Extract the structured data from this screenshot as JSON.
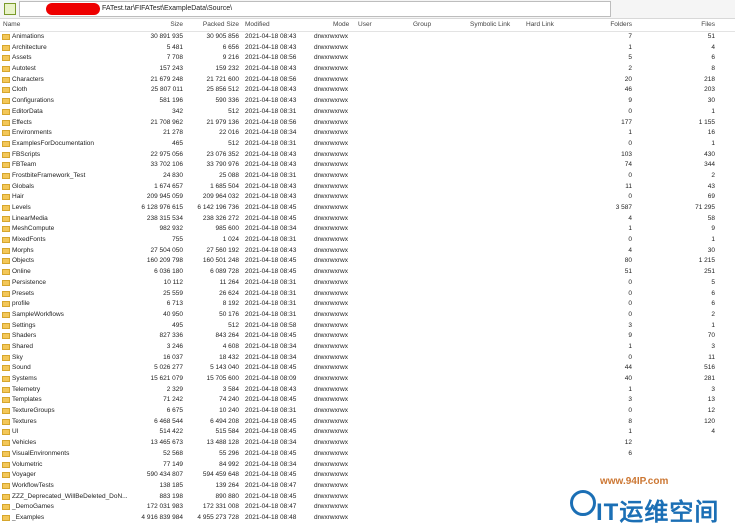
{
  "address_bar": {
    "path": "FATest.tar\\FIFATest\\ExampleData\\Source\\"
  },
  "columns": {
    "name": "Name",
    "size": "Size",
    "packed": "Packed Size",
    "modified": "Modified",
    "mode": "Mode",
    "user": "User",
    "group": "Group",
    "symlink": "Symbolic Link",
    "hardlink": "Hard Link",
    "folders": "Folders",
    "files": "Files"
  },
  "rows": [
    {
      "name": "Animations",
      "size": "30 891 935",
      "packed": "30 905 856",
      "modified": "2021-04-18 08:43",
      "mode": "drwxrwxrwx",
      "folders": "7",
      "files": "51"
    },
    {
      "name": "Architecture",
      "size": "5 481",
      "packed": "6 656",
      "modified": "2021-04-18 08:43",
      "mode": "drwxrwxrwx",
      "folders": "1",
      "files": "4"
    },
    {
      "name": "Assets",
      "size": "7 708",
      "packed": "9 216",
      "modified": "2021-04-18 08:56",
      "mode": "drwxrwxrwx",
      "folders": "5",
      "files": "6"
    },
    {
      "name": "Autotest",
      "size": "157 243",
      "packed": "159 232",
      "modified": "2021-04-18 08:43",
      "mode": "drwxrwxrwx",
      "folders": "2",
      "files": "8"
    },
    {
      "name": "Characters",
      "size": "21 679 248",
      "packed": "21 721 600",
      "modified": "2021-04-18 08:56",
      "mode": "drwxrwxrwx",
      "folders": "20",
      "files": "218"
    },
    {
      "name": "Cloth",
      "size": "25 807 011",
      "packed": "25 856 512",
      "modified": "2021-04-18 08:43",
      "mode": "drwxrwxrwx",
      "folders": "46",
      "files": "203"
    },
    {
      "name": "Configurations",
      "size": "581 196",
      "packed": "590 336",
      "modified": "2021-04-18 08:43",
      "mode": "drwxrwxrwx",
      "folders": "9",
      "files": "30"
    },
    {
      "name": "EditorData",
      "size": "342",
      "packed": "512",
      "modified": "2021-04-18 08:31",
      "mode": "drwxrwxrwx",
      "folders": "0",
      "files": "1"
    },
    {
      "name": "Effects",
      "size": "21 708 962",
      "packed": "21 979 136",
      "modified": "2021-04-18 08:56",
      "mode": "drwxrwxrwx",
      "folders": "177",
      "files": "1 155"
    },
    {
      "name": "Environments",
      "size": "21 278",
      "packed": "22 016",
      "modified": "2021-04-18 08:34",
      "mode": "drwxrwxrwx",
      "folders": "1",
      "files": "16"
    },
    {
      "name": "ExamplesForDocumentation",
      "size": "465",
      "packed": "512",
      "modified": "2021-04-18 08:31",
      "mode": "drwxrwxrwx",
      "folders": "0",
      "files": "1"
    },
    {
      "name": "FBScripts",
      "size": "22 975 056",
      "packed": "23 076 352",
      "modified": "2021-04-18 08:43",
      "mode": "drwxrwxrwx",
      "folders": "103",
      "files": "430"
    },
    {
      "name": "FBTeam",
      "size": "33 702 106",
      "packed": "33 790 976",
      "modified": "2021-04-18 08:43",
      "mode": "drwxrwxrwx",
      "folders": "74",
      "files": "344"
    },
    {
      "name": "FrostbiteFramework_Test",
      "size": "24 830",
      "packed": "25 088",
      "modified": "2021-04-18 08:31",
      "mode": "drwxrwxrwx",
      "folders": "0",
      "files": "2"
    },
    {
      "name": "Globals",
      "size": "1 674 657",
      "packed": "1 685 504",
      "modified": "2021-04-18 08:43",
      "mode": "drwxrwxrwx",
      "folders": "11",
      "files": "43"
    },
    {
      "name": "Hair",
      "size": "209 945 059",
      "packed": "209 964 032",
      "modified": "2021-04-18 08:43",
      "mode": "drwxrwxrwx",
      "folders": "0",
      "files": "69"
    },
    {
      "name": "Levels",
      "size": "6 128 976 615",
      "packed": "6 142 196 736",
      "modified": "2021-04-18 08:45",
      "mode": "drwxrwxrwx",
      "folders": "3 587",
      "files": "71 295"
    },
    {
      "name": "LinearMedia",
      "size": "238 315 534",
      "packed": "238 326 272",
      "modified": "2021-04-18 08:45",
      "mode": "drwxrwxrwx",
      "folders": "4",
      "files": "58"
    },
    {
      "name": "MeshCompute",
      "size": "982 932",
      "packed": "985 600",
      "modified": "2021-04-18 08:34",
      "mode": "drwxrwxrwx",
      "folders": "1",
      "files": "9"
    },
    {
      "name": "MixedFonts",
      "size": "755",
      "packed": "1 024",
      "modified": "2021-04-18 08:31",
      "mode": "drwxrwxrwx",
      "folders": "0",
      "files": "1"
    },
    {
      "name": "Morphs",
      "size": "27 504 050",
      "packed": "27 560 192",
      "modified": "2021-04-18 08:43",
      "mode": "drwxrwxrwx",
      "folders": "4",
      "files": "30"
    },
    {
      "name": "Objects",
      "size": "160 209 798",
      "packed": "160 501 248",
      "modified": "2021-04-18 08:45",
      "mode": "drwxrwxrwx",
      "folders": "80",
      "files": "1 215"
    },
    {
      "name": "Online",
      "size": "6 036 180",
      "packed": "6 089 728",
      "modified": "2021-04-18 08:45",
      "mode": "drwxrwxrwx",
      "folders": "51",
      "files": "251"
    },
    {
      "name": "Persistence",
      "size": "10 112",
      "packed": "11 264",
      "modified": "2021-04-18 08:31",
      "mode": "drwxrwxrwx",
      "folders": "0",
      "files": "5"
    },
    {
      "name": "Presets",
      "size": "25 559",
      "packed": "26 624",
      "modified": "2021-04-18 08:31",
      "mode": "drwxrwxrwx",
      "folders": "0",
      "files": "6"
    },
    {
      "name": "profile",
      "size": "6 713",
      "packed": "8 192",
      "modified": "2021-04-18 08:31",
      "mode": "drwxrwxrwx",
      "folders": "0",
      "files": "6"
    },
    {
      "name": "SampleWorkflows",
      "size": "40 950",
      "packed": "50 176",
      "modified": "2021-04-18 08:31",
      "mode": "drwxrwxrwx",
      "folders": "0",
      "files": "2"
    },
    {
      "name": "Settings",
      "size": "495",
      "packed": "512",
      "modified": "2021-04-18 08:58",
      "mode": "drwxrwxrwx",
      "folders": "3",
      "files": "1"
    },
    {
      "name": "Shaders",
      "size": "827 336",
      "packed": "843 264",
      "modified": "2021-04-18 08:45",
      "mode": "drwxrwxrwx",
      "folders": "9",
      "files": "70"
    },
    {
      "name": "Shared",
      "size": "3 246",
      "packed": "4 608",
      "modified": "2021-04-18 08:34",
      "mode": "drwxrwxrwx",
      "folders": "1",
      "files": "3"
    },
    {
      "name": "Sky",
      "size": "16 037",
      "packed": "18 432",
      "modified": "2021-04-18 08:34",
      "mode": "drwxrwxrwx",
      "folders": "0",
      "files": "11"
    },
    {
      "name": "Sound",
      "size": "5 026 277",
      "packed": "5 143 040",
      "modified": "2021-04-18 08:45",
      "mode": "drwxrwxrwx",
      "folders": "44",
      "files": "516"
    },
    {
      "name": "Systems",
      "size": "15 621 079",
      "packed": "15 705 600",
      "modified": "2021-04-18 08:09",
      "mode": "drwxrwxrwx",
      "folders": "40",
      "files": "281"
    },
    {
      "name": "Telemetry",
      "size": "2 329",
      "packed": "3 584",
      "modified": "2021-04-18 08:43",
      "mode": "drwxrwxrwx",
      "folders": "1",
      "files": "3"
    },
    {
      "name": "Templates",
      "size": "71 242",
      "packed": "74 240",
      "modified": "2021-04-18 08:45",
      "mode": "drwxrwxrwx",
      "folders": "3",
      "files": "13"
    },
    {
      "name": "TextureGroups",
      "size": "6 675",
      "packed": "10 240",
      "modified": "2021-04-18 08:31",
      "mode": "drwxrwxrwx",
      "folders": "0",
      "files": "12"
    },
    {
      "name": "Textures",
      "size": "6 468 544",
      "packed": "6 494 208",
      "modified": "2021-04-18 08:45",
      "mode": "drwxrwxrwx",
      "folders": "8",
      "files": "120"
    },
    {
      "name": "UI",
      "size": "514 422",
      "packed": "515 584",
      "modified": "2021-04-18 08:45",
      "mode": "drwxrwxrwx",
      "folders": "1",
      "files": "4"
    },
    {
      "name": "Vehicles",
      "size": "13 465 673",
      "packed": "13 488 128",
      "modified": "2021-04-18 08:34",
      "mode": "drwxrwxrwx",
      "folders": "12",
      "files": ""
    },
    {
      "name": "VisualEnvironments",
      "size": "52 568",
      "packed": "55 296",
      "modified": "2021-04-18 08:45",
      "mode": "drwxrwxrwx",
      "folders": "6",
      "files": ""
    },
    {
      "name": "Volumetric",
      "size": "77 149",
      "packed": "84 992",
      "modified": "2021-04-18 08:34",
      "mode": "drwxrwxrwx",
      "folders": "",
      "files": ""
    },
    {
      "name": "Voyager",
      "size": "590 434 807",
      "packed": "594 459 648",
      "modified": "2021-04-18 08:45",
      "mode": "drwxrwxrwx",
      "folders": "",
      "files": ""
    },
    {
      "name": "WorkflowTests",
      "size": "138 185",
      "packed": "139 264",
      "modified": "2021-04-18 08:47",
      "mode": "drwxrwxrwx",
      "folders": "",
      "files": ""
    },
    {
      "name": "ZZZ_Deprecated_WillBeDeleted_DoN...",
      "size": "883 198",
      "packed": "890 880",
      "modified": "2021-04-18 08:45",
      "mode": "drwxrwxrwx",
      "folders": "",
      "files": ""
    },
    {
      "name": "_DemoGames",
      "size": "172 031 983",
      "packed": "172 331 008",
      "modified": "2021-04-18 08:47",
      "mode": "drwxrwxrwx",
      "folders": "",
      "files": ""
    },
    {
      "name": "_Examples",
      "size": "4 916 839 984",
      "packed": "4 955 273 728",
      "modified": "2021-04-18 08:48",
      "mode": "drwxrwxrwx",
      "folders": "",
      "files": ""
    }
  ],
  "watermark": {
    "url": "www.94IP.com",
    "text": "IT运维空间"
  }
}
